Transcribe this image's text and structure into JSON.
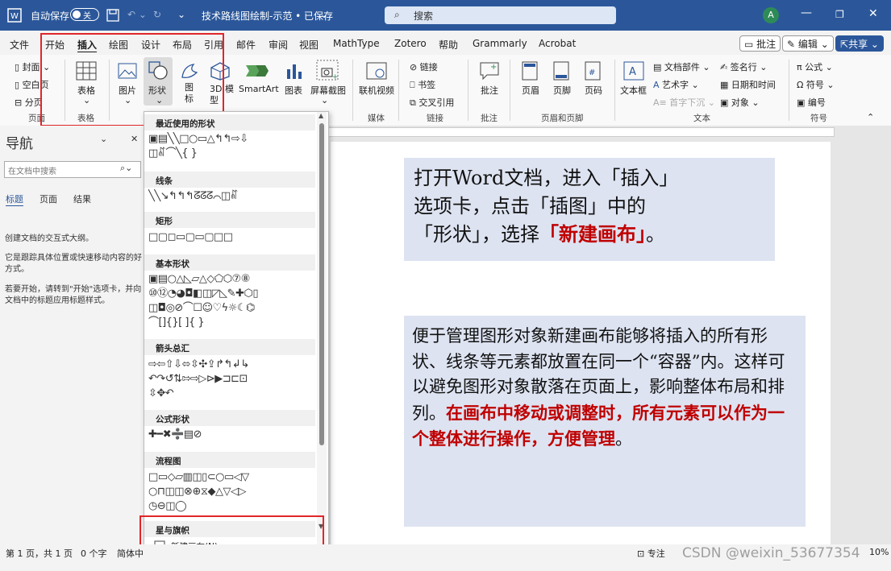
{
  "titlebar": {
    "autosave_label": "自动保存",
    "autosave_state": "关",
    "doc_title": "技术路线图绘制-示范 • 已保存",
    "search_placeholder": "搜索",
    "avatar_initial": "A",
    "bg_color": "#2b579a"
  },
  "tabs": [
    "文件",
    "开始",
    "插入",
    "绘图",
    "设计",
    "布局",
    "引用",
    "邮件",
    "审阅",
    "视图",
    "MathType",
    "Zotero",
    "帮助",
    "Grammarly",
    "Acrobat"
  ],
  "active_tab": "插入",
  "top_right": {
    "comments": "批注",
    "editing": "编辑",
    "share": "共享"
  },
  "ribbon": {
    "pages": {
      "cover": "封面",
      "blank": "空白页",
      "break": "分页",
      "group": "页面"
    },
    "table": {
      "label": "表格",
      "group": "表格"
    },
    "illustrations": {
      "picture": "图片",
      "shapes": "形状",
      "icons": "图标",
      "model3d": "3D 模型",
      "smartart": "SmartArt",
      "chart": "图表",
      "screenshot": "屏幕截图"
    },
    "media": {
      "video": "联机视频",
      "group": "媒体"
    },
    "links": {
      "link": "链接",
      "bookmark": "书签",
      "crossref": "交叉引用",
      "group": "链接"
    },
    "comments": {
      "comment": "批注",
      "group": "批注"
    },
    "header_footer": {
      "header": "页眉",
      "footer": "页脚",
      "page_number": "页码",
      "group": "页眉和页脚"
    },
    "text": {
      "textbox": "文本框",
      "parts": "文档部件",
      "wordart": "艺术字",
      "dropcap": "首字下沉",
      "signature": "签名行",
      "datetime": "日期和时间",
      "object": "对象",
      "group": "文本"
    },
    "symbols": {
      "equation": "公式",
      "symbol": "符号",
      "number": "编号",
      "group": "符号"
    }
  },
  "nav": {
    "title": "导航",
    "search_placeholder": "在文档中搜索",
    "tabs": [
      "标题",
      "页面",
      "结果"
    ],
    "desc1": "创建文档的交互式大纲。",
    "desc2": "它是跟踪具体位置或快速移动内容的好方式。",
    "desc3": "若要开始，请转到\"开始\"选项卡，并向文档中的标题应用标题样式。"
  },
  "shapes_menu": {
    "sections": [
      "最近使用的形状",
      "线条",
      "矩形",
      "基本形状",
      "箭头总汇",
      "公式形状",
      "流程图",
      "星与旗帜"
    ],
    "new_canvas": "新建画布(N)"
  },
  "callout1": {
    "line1": "打开Word文档，进入「插入」",
    "line2": "选项卡，点击「插图」中的",
    "line3_pre": "「形状」，选择",
    "line3_red": "「新建画布」",
    "line3_post": "。"
  },
  "callout2": {
    "normal": "便于管理图形对象新建画布能够将插入的所有形状、线条等元素都放置在同一个“容器”内。这样可以避免图形对象散落在页面上，影响整体布局和排列。",
    "red": "在画布中移动或调整时，所有元素可以作为一个整体进行操作，方便管理",
    "end": "。"
  },
  "status": {
    "page": "第 1 页，共 1 页",
    "words": "0 个字",
    "lang": "简体中",
    "focus": "专注",
    "zoom": "10%"
  },
  "watermark": "CSDN @weixin_53677354",
  "highlight_color": "#e0262a",
  "callout_bg": "#dde3f1",
  "accent_red": "#c00000"
}
